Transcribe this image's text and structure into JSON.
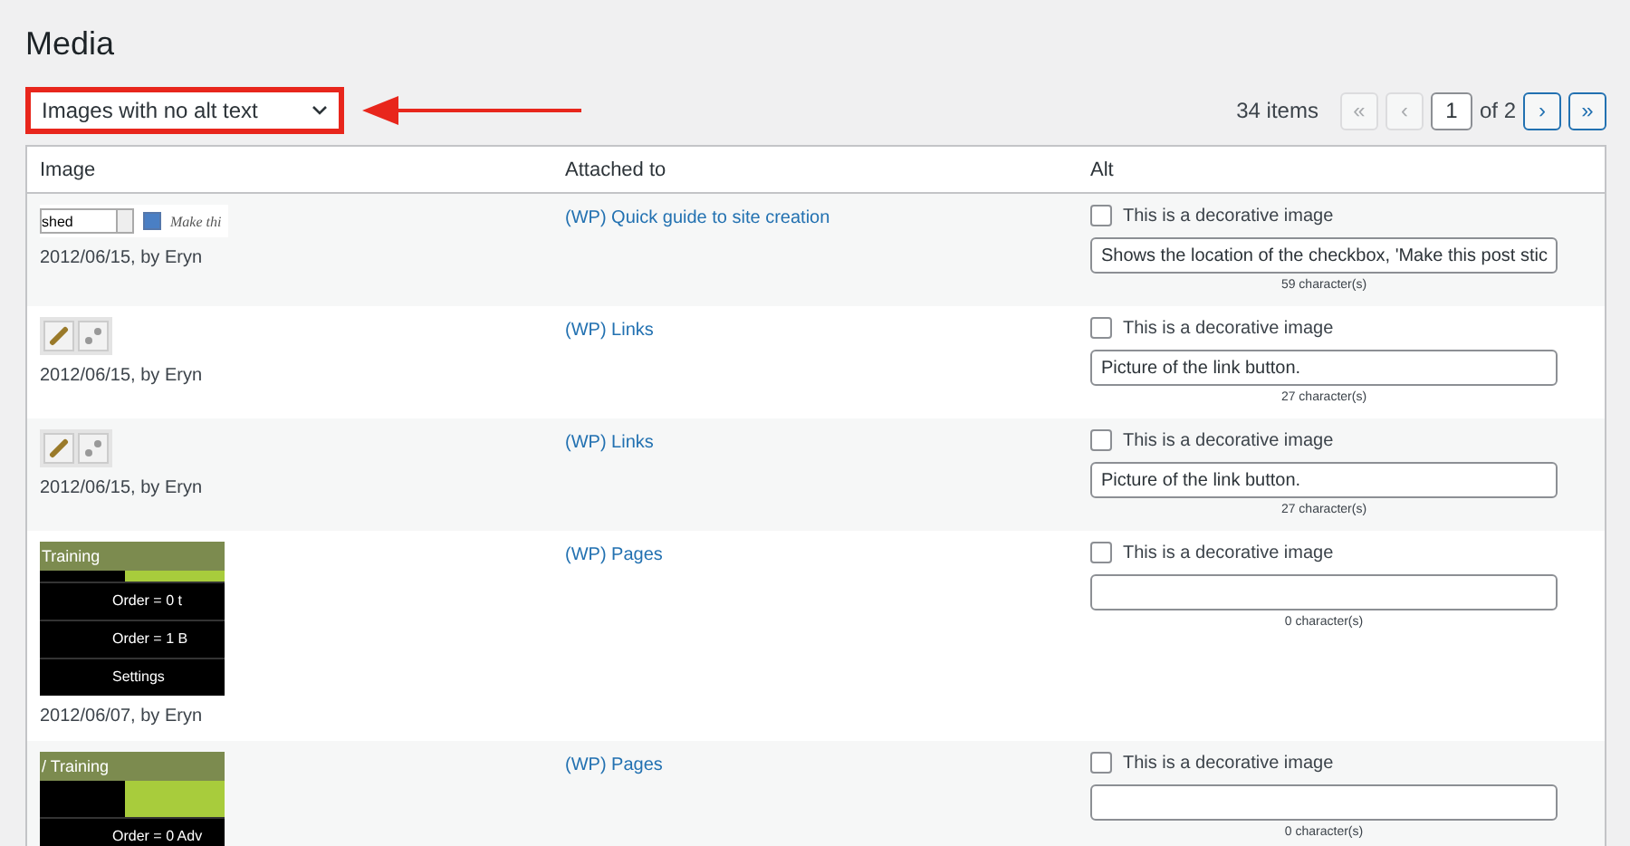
{
  "title": "Media",
  "filter": {
    "value": "Images with no alt text"
  },
  "pagination": {
    "count": "34 items",
    "buttons": [
      {
        "label": "«",
        "disabled": true
      },
      {
        "label": "‹",
        "disabled": true
      }
    ],
    "page": "1",
    "of": "of 2",
    "next_buttons": [
      {
        "label": "›",
        "disabled": false
      },
      {
        "label": "»",
        "disabled": false
      }
    ]
  },
  "columns": [
    "Image",
    "Attached to",
    "Alt"
  ],
  "rows": [
    {
      "thumbnail": {
        "kind": "form",
        "select": "shed",
        "checkbox_label": "Make thi",
        "checked": true
      },
      "meta": "2012/06/15, by Eryn",
      "attached": "(WP) Quick guide to site creation",
      "decorative": {
        "label": "This is a decorative image",
        "checked": false
      },
      "alt": "Shows the location of the checkbox, 'Make this post stic",
      "count": "59 character(s)"
    },
    {
      "thumbnail": {
        "kind": "link-buttons"
      },
      "meta": "2012/06/15, by Eryn",
      "attached": "(WP) Links",
      "decorative": {
        "label": "This is a decorative image",
        "checked": false
      },
      "alt": "Picture of the link button.",
      "count": "27 character(s)"
    },
    {
      "thumbnail": {
        "kind": "link-buttons"
      },
      "meta": "2012/06/15, by Eryn",
      "attached": "(WP) Links",
      "decorative": {
        "label": "This is a decorative image",
        "checked": false
      },
      "alt": "Picture of the link button.",
      "count": "27 character(s)"
    },
    {
      "thumbnail": {
        "kind": "menu",
        "heading": "Training",
        "lines": [
          "Order = 0 t",
          "Order = 1 B",
          "Settings"
        ]
      },
      "meta": "2012/06/07, by Eryn",
      "attached": "(WP) Pages",
      "decorative": {
        "label": "This is a decorative image",
        "checked": false
      },
      "alt": "",
      "count": "0 character(s)"
    },
    {
      "thumbnail": {
        "kind": "menu",
        "heading": "/ Training",
        "lines": [
          "Order = 0 Adv"
        ]
      },
      "attached": "(WP) Pages",
      "decorative": {
        "label": "This is a decorative image",
        "checked": false
      },
      "alt": "",
      "count": "0 character(s)"
    }
  ]
}
